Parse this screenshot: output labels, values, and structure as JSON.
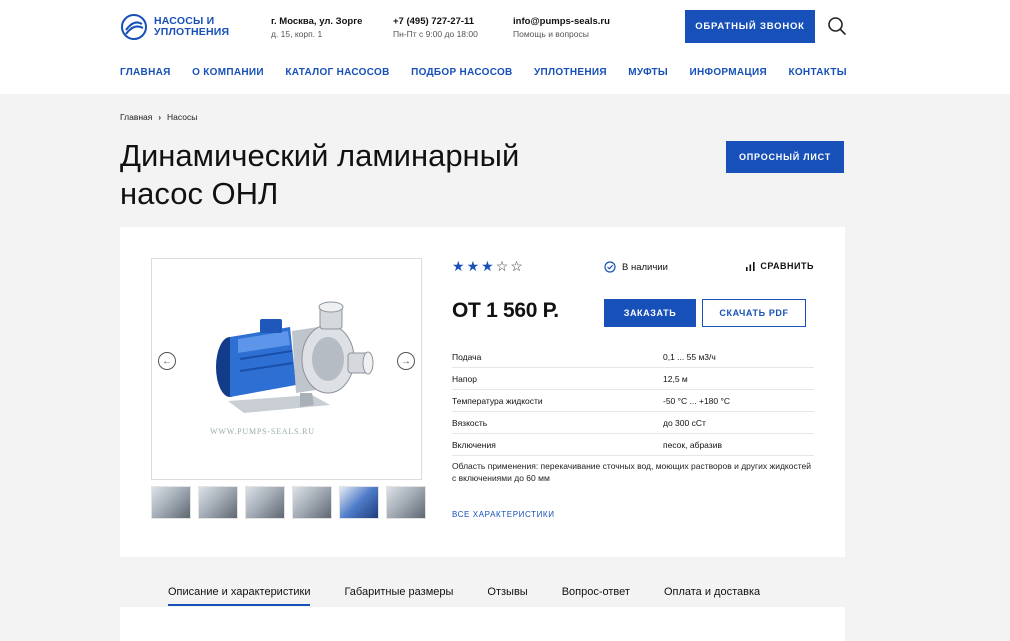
{
  "header": {
    "logo": {
      "line1": "НАСОСЫ И",
      "line2": "УПЛОТНЕНИЯ"
    },
    "address": {
      "line1": "г. Москва, ул. Зорге",
      "line2": "д. 15, корп. 1"
    },
    "phone": {
      "line1": "+7 (495) 727-27-11",
      "line2": "Пн-Пт с 9:00 до 18:00"
    },
    "email": {
      "line1": "info@pumps-seals.ru",
      "line2": "Помощь и вопросы"
    },
    "callback_label": "ОБРАТНЫЙ ЗВОНОК",
    "search_icon": "search-icon",
    "brand_color": "#1650b8"
  },
  "nav": [
    {
      "label": "ГЛАВНАЯ"
    },
    {
      "label": "О КОМПАНИИ"
    },
    {
      "label": "КАТАЛОГ НАСОСОВ"
    },
    {
      "label": "ПОДБОР НАСОСОВ"
    },
    {
      "label": "УПЛОТНЕНИЯ"
    },
    {
      "label": "МУФТЫ"
    },
    {
      "label": "ИНФОРМАЦИЯ"
    },
    {
      "label": "КОНТАКТЫ"
    }
  ],
  "breadcrumb": {
    "home": "Главная",
    "current": "Насосы",
    "separator": "›"
  },
  "page": {
    "title_line1": "Динамический ламинарный",
    "title_line2": "насос ОНЛ",
    "survey_label": "ОПРОСНЫЙ ЛИСТ"
  },
  "product": {
    "rating": 3,
    "rating_max": 5,
    "stock": "В наличии",
    "compare_label": "СРАВНИТЬ",
    "price": "ОТ 1 560 Р.",
    "order_label": "ЗАКАЗАТЬ",
    "pdf_label": "СКАЧАТЬ PDF",
    "watermark": "WWW.PUMPS-SEALS.RU",
    "specs": [
      {
        "key": "Подача",
        "value": "0,1 ... 55 м3/ч"
      },
      {
        "key": "Напор",
        "value": "12,5 м"
      },
      {
        "key": "Температура жидкости",
        "value": "-50 °C ... +180 °C"
      },
      {
        "key": "Вязкость",
        "value": "до 300 сСт"
      },
      {
        "key": "Включения",
        "value": "песок, абразив"
      }
    ],
    "description": "Область применения: перекачивание сточных вод, моющих растворов и других жидкостей с включениями до 60 мм",
    "all_specs_label": "ВСЕ ХАРАКТЕРИСТИКИ",
    "thumbnails": 6
  },
  "tabs": [
    {
      "label": "Описание и характеристики",
      "active": true
    },
    {
      "label": "Габаритные размеры",
      "active": false
    },
    {
      "label": "Отзывы",
      "active": false
    },
    {
      "label": "Вопрос-ответ",
      "active": false
    },
    {
      "label": "Оплата и доставка",
      "active": false
    }
  ]
}
